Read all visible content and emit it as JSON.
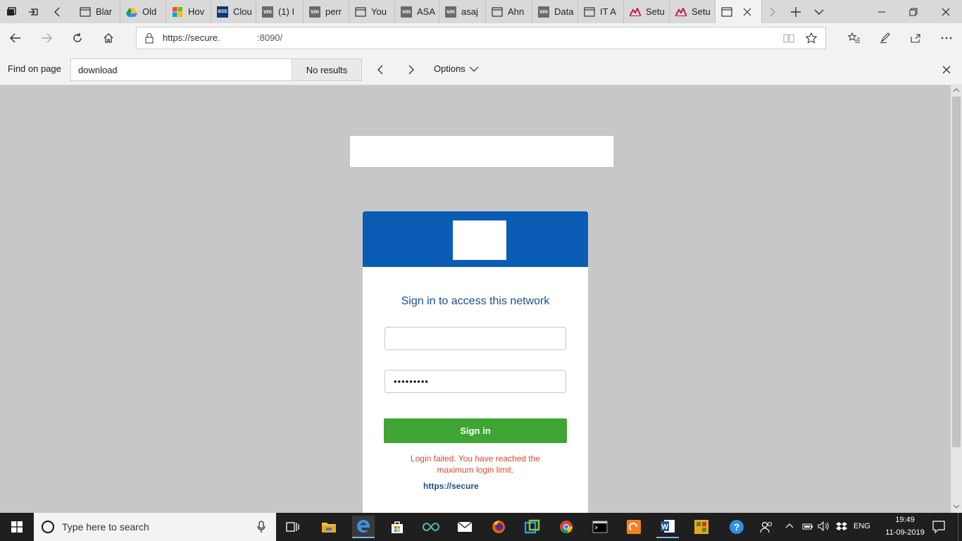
{
  "browser": {
    "tabs": [
      {
        "label": "Blar",
        "favicon": "page-icon"
      },
      {
        "label": "Old",
        "favicon": "drive-icon"
      },
      {
        "label": "Hov",
        "favicon": "microsoft-icon"
      },
      {
        "label": "Clou",
        "favicon": "ieee-icon"
      },
      {
        "label": "(1) I",
        "favicon": "vm-icon"
      },
      {
        "label": "perr",
        "favicon": "vm-icon"
      },
      {
        "label": "You",
        "favicon": "page-icon"
      },
      {
        "label": "ASA",
        "favicon": "vm-icon"
      },
      {
        "label": "asaj",
        "favicon": "vm-icon"
      },
      {
        "label": "Ahn",
        "favicon": "page-icon"
      },
      {
        "label": "Data",
        "favicon": "vm-icon"
      },
      {
        "label": "IT A",
        "favicon": "page-icon"
      },
      {
        "label": "Setu",
        "favicon": "mountain-icon"
      },
      {
        "label": "Setu",
        "favicon": "mountain-icon"
      },
      {
        "label": "",
        "favicon": "page-icon"
      }
    ],
    "ieee_badge": "IEEE",
    "vm_badge": "vm",
    "url_host": "https://secure.",
    "url_port": ":8090/"
  },
  "find_bar": {
    "label": "Find on page",
    "query": "download",
    "results": "No results",
    "options_label": "Options"
  },
  "login": {
    "title": "Sign in to access this network",
    "username_value": "",
    "password_value": "•••••••••",
    "signin_label": "Sign in",
    "error_message": "Login failed. You have reached the maximum login limit.",
    "portal_link": "https://secure"
  },
  "taskbar": {
    "search_placeholder": "Type here to search",
    "language": "ENG",
    "time": "19:49",
    "date": "11-09-2019"
  },
  "colors": {
    "header_blue": "#0b5cb5",
    "signin_green": "#3fa535",
    "error_red": "#d14b2b"
  }
}
